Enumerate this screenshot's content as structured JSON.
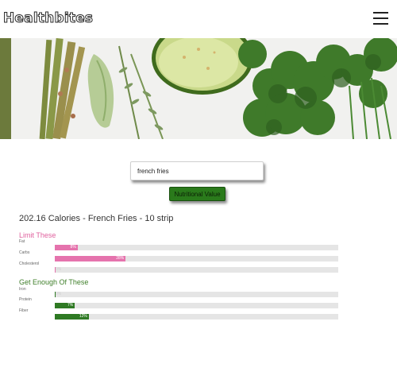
{
  "header": {
    "brand": "Healthbites",
    "menu_icon": "hamburger-menu-icon"
  },
  "hero": {
    "description_icon": "vegetables-banner-image"
  },
  "search": {
    "value": "french fries",
    "button_label": "Nutritional Value"
  },
  "result": {
    "title": "202.16 Calories - French Fries - 10 strip"
  },
  "limit": {
    "title": "Limit These",
    "color": "#e573ad",
    "nutrients": [
      {
        "label": "Fat",
        "percent": 8,
        "text": "8%"
      },
      {
        "label": "Carbs",
        "percent": 25,
        "text": "28%"
      },
      {
        "label": "Cholesterol",
        "percent": 0,
        "text": "0%"
      }
    ]
  },
  "enough": {
    "title": "Get Enough Of These",
    "color": "#2f7a24",
    "nutrients": [
      {
        "label": "Iron",
        "percent": 0,
        "text": "0%"
      },
      {
        "label": "Protein",
        "percent": 7,
        "text": "7%"
      },
      {
        "label": "Fiber",
        "percent": 12,
        "text": "12%"
      }
    ]
  }
}
